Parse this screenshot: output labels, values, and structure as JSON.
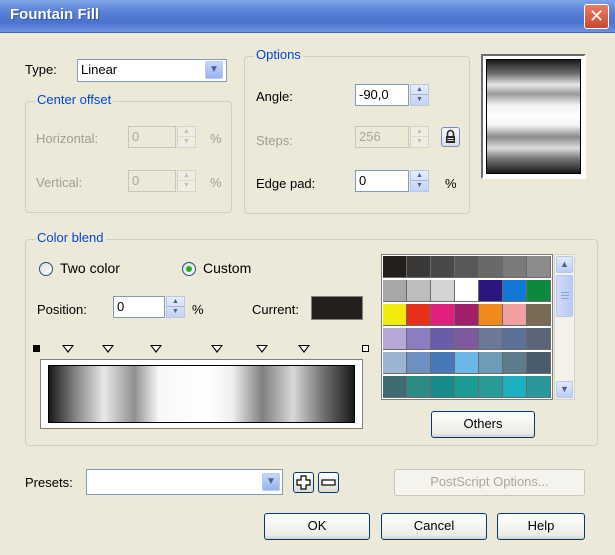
{
  "window": {
    "title": "Fountain Fill",
    "close_glyph": "✕"
  },
  "type": {
    "label": "Type:",
    "value": "Linear"
  },
  "center_offset": {
    "legend": "Center offset",
    "horizontal": {
      "label": "Horizontal:",
      "value": "0",
      "unit": "%"
    },
    "vertical": {
      "label": "Vertical:",
      "value": "0",
      "unit": "%"
    }
  },
  "options": {
    "legend": "Options",
    "angle": {
      "label": "Angle:",
      "value": "-90,0"
    },
    "steps": {
      "label": "Steps:",
      "value": "256"
    },
    "edge_pad": {
      "label": "Edge pad:",
      "value": "0",
      "unit": "%"
    }
  },
  "color_blend": {
    "legend": "Color blend",
    "two_color_label": "Two color",
    "custom_label": "Custom",
    "selected_mode": "custom",
    "position": {
      "label": "Position:",
      "value": "0",
      "unit": "%"
    },
    "current_label": "Current:",
    "current_color": "#231f1d",
    "palette": [
      "#231f1d",
      "#3b3838",
      "#4a4848",
      "#5a5757",
      "#6b6868",
      "#7c7979",
      "#8e8b8b",
      "#a8a6a6",
      "#bebcbc",
      "#d5d4d4",
      "#ffffff",
      "#2c1680",
      "#1278d8",
      "#0a8a3c",
      "#f0eb0a",
      "#e8301a",
      "#e0207c",
      "#a0206c",
      "#f08a1c",
      "#f0a0a0",
      "#7a6a58",
      "#b8a8d8",
      "#8c7cc0",
      "#6a5ca8",
      "#7c5a9c",
      "#6c7898",
      "#5c7098",
      "#5c6478",
      "#9cb4d4",
      "#6c90c0",
      "#4878b8",
      "#6ab8e8",
      "#6c9cb8",
      "#5c7c8c",
      "#485c6c",
      "#3c6c70",
      "#2c8c84",
      "#188c8c",
      "#1c9c94",
      "#289c98",
      "#1cb0c0",
      "#28989c"
    ],
    "others_label": "Others"
  },
  "presets": {
    "label": "Presets:",
    "value": ""
  },
  "postscript_label": "PostScript Options...",
  "buttons": {
    "ok": "OK",
    "cancel": "Cancel",
    "help": "Help"
  }
}
